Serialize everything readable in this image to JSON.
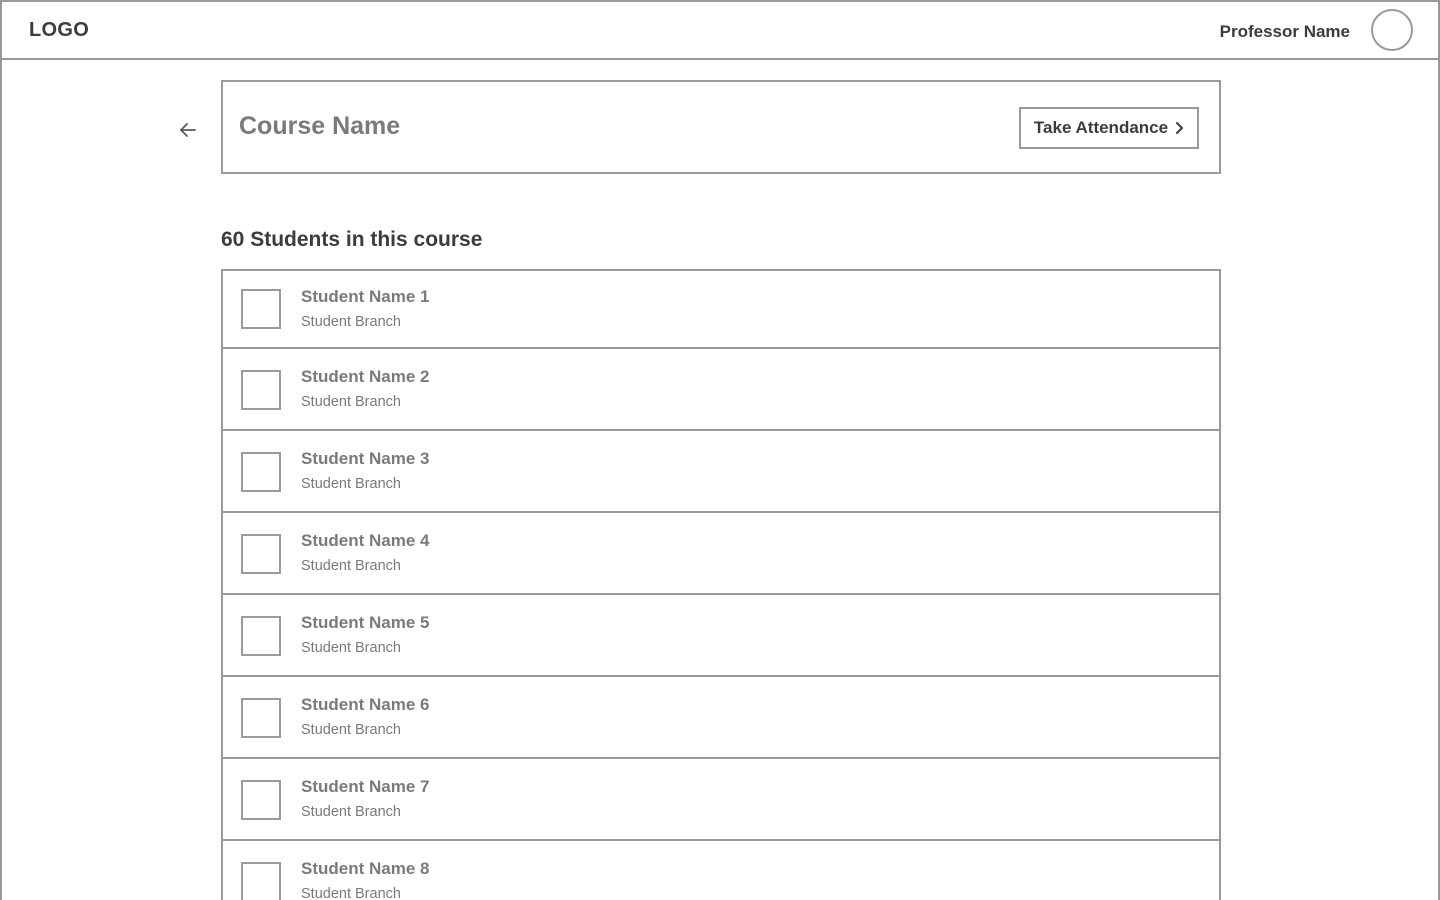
{
  "header": {
    "logo": "LOGO",
    "professor_name": "Professor Name"
  },
  "course": {
    "name": "Course Name",
    "action_label": "Take Attendance"
  },
  "students_heading": "60 Students in this course",
  "students": [
    {
      "name": "Student Name 1",
      "branch": "Student Branch"
    },
    {
      "name": "Student Name 2",
      "branch": "Student Branch"
    },
    {
      "name": "Student Name 3",
      "branch": "Student Branch"
    },
    {
      "name": "Student Name 4",
      "branch": "Student Branch"
    },
    {
      "name": "Student Name 5",
      "branch": "Student Branch"
    },
    {
      "name": "Student Name 6",
      "branch": "Student Branch"
    },
    {
      "name": "Student Name 7",
      "branch": "Student Branch"
    },
    {
      "name": "Student Name 8",
      "branch": "Student Branch"
    }
  ]
}
